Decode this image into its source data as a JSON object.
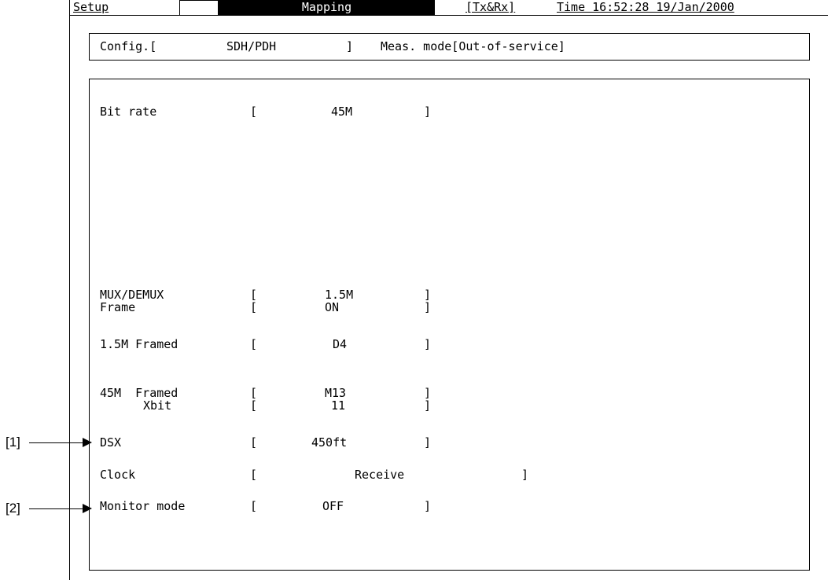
{
  "header": {
    "tab_setup": "Setup",
    "tab_mapping": "Mapping",
    "tx_rx": "[Tx&Rx]",
    "time": "Time 16:52:28 19/Jan/2000"
  },
  "config_bar": {
    "config_label": "Config.[",
    "config_value": "SDH/PDH",
    "config_close": "]",
    "meas_mode": "Meas. mode[Out-of-service]"
  },
  "settings": {
    "bit_rate": {
      "label": "Bit rate",
      "value": "45M"
    },
    "mux_demux": {
      "label": "MUX/DEMUX",
      "value": "1.5M"
    },
    "frame": {
      "label": "Frame",
      "value": "ON"
    },
    "framed_15m": {
      "label": "1.5M Framed",
      "value": "D4"
    },
    "framed_45m": {
      "label": "45M  Framed",
      "value": "M13"
    },
    "xbit": {
      "label": "Xbit",
      "value": "11"
    },
    "dsx": {
      "label": "DSX",
      "value": "450ft"
    },
    "clock": {
      "label": "Clock",
      "value": "Receive"
    },
    "monitor_mode": {
      "label": "Monitor mode",
      "value": "OFF"
    }
  },
  "brackets": {
    "open": "[",
    "close": "]"
  },
  "callouts": {
    "c1": "[1]",
    "c2": "[2]"
  }
}
